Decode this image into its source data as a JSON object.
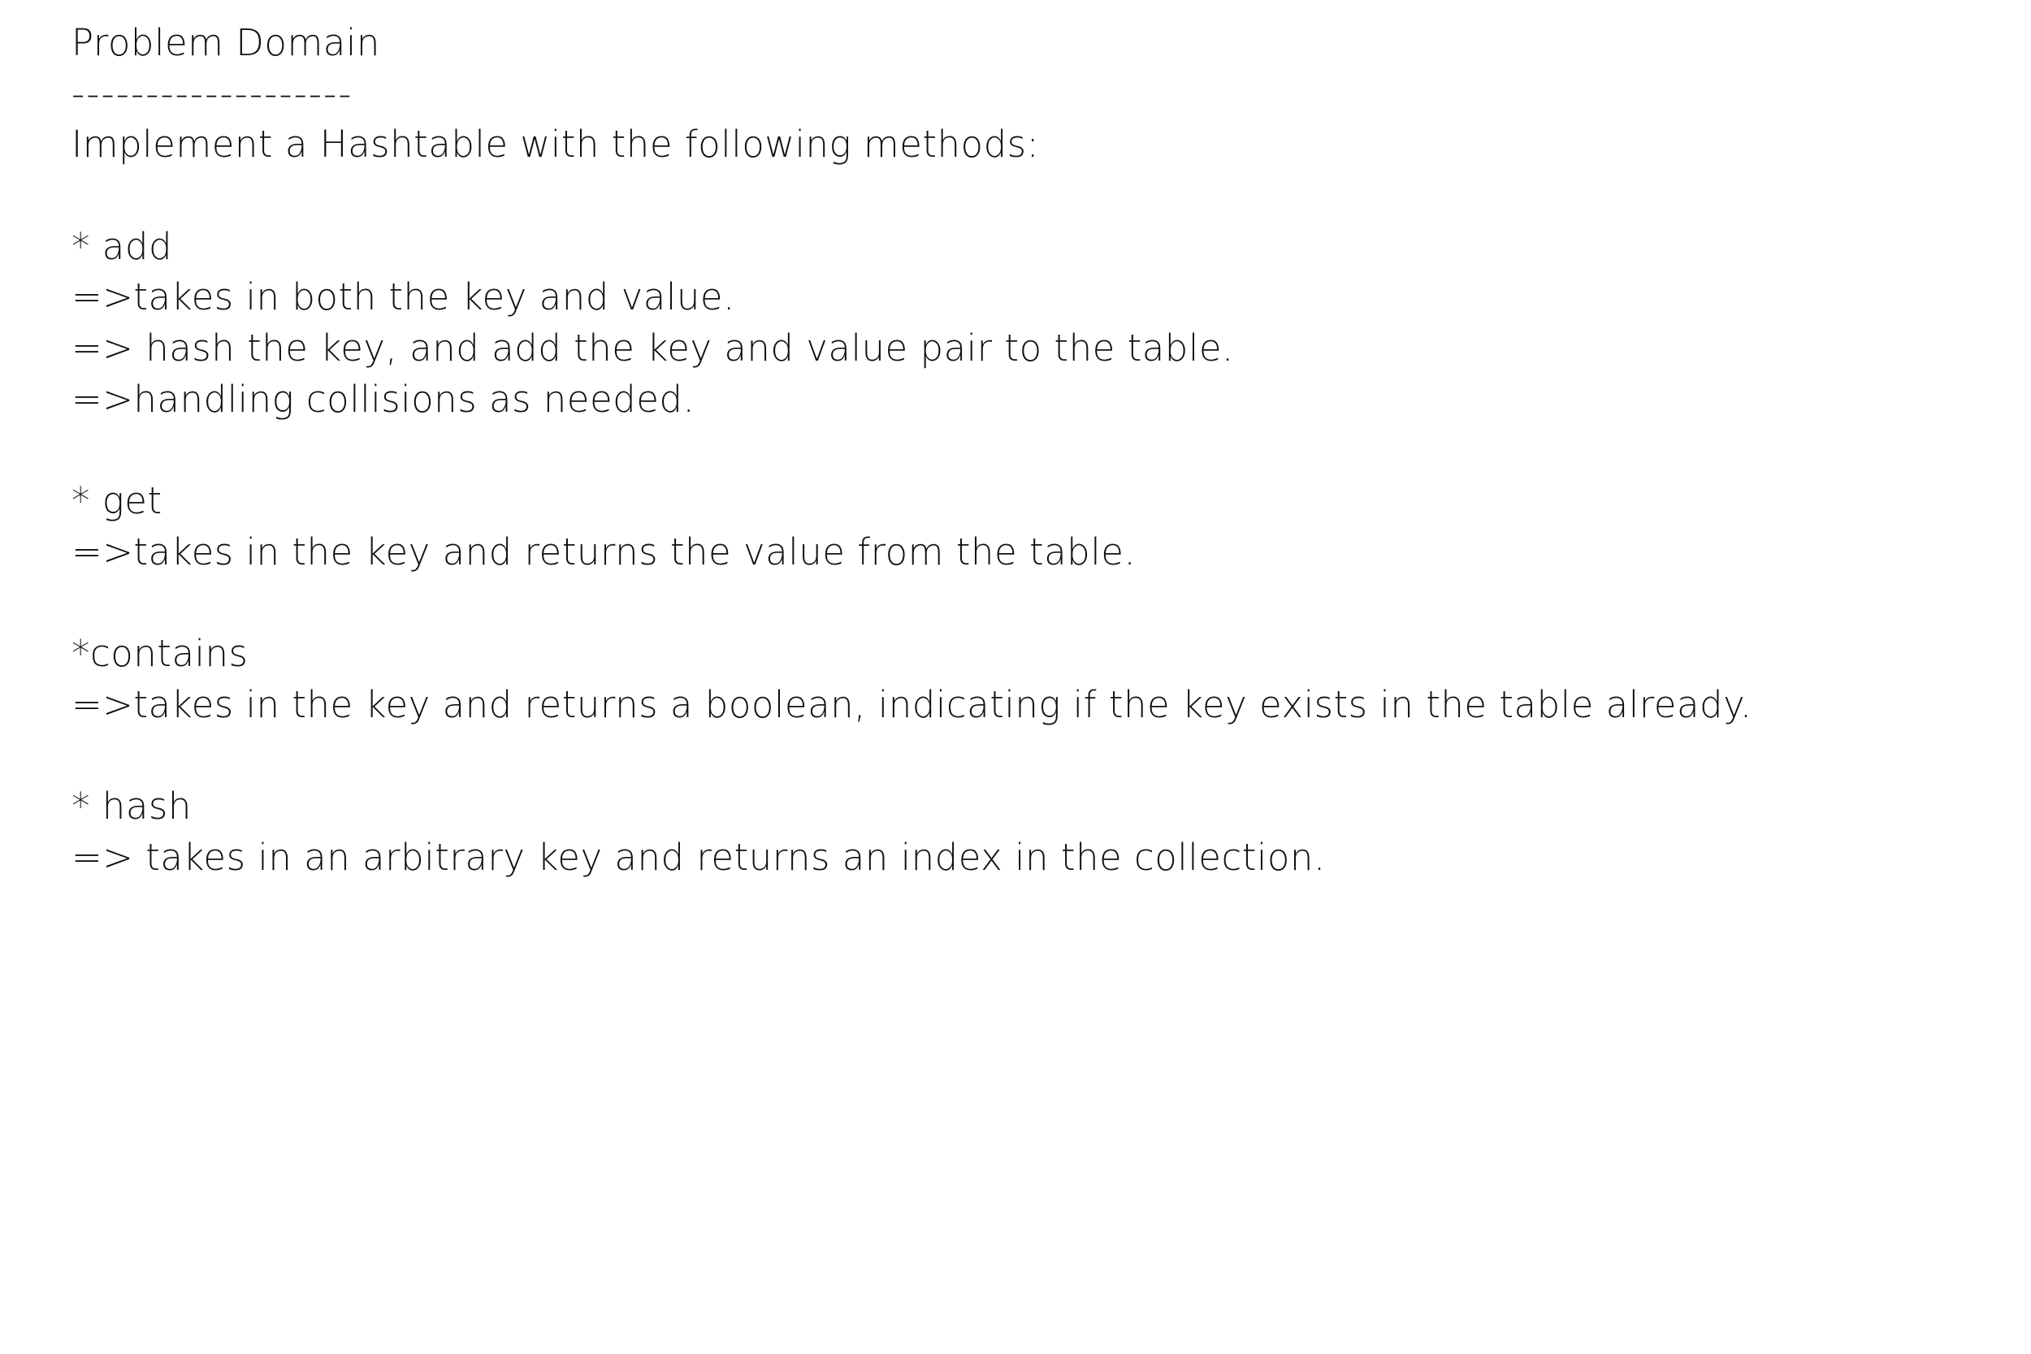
{
  "document": {
    "lines": [
      "Problem Domain",
      "-------------------",
      "Implement a Hashtable with the following methods:",
      "",
      "* add",
      "=>takes in both the key and value.",
      "=> hash the key, and add the key and value pair to the table.",
      "=>handling collisions as needed.",
      "",
      "* get",
      "=>takes in the key and returns the value from the table.",
      "",
      "*contains",
      "=>takes in the key and returns a boolean, indicating if the key exists in the table already.",
      "",
      "* hash",
      "=> takes in an arbitrary key and returns an index in the collection."
    ]
  }
}
